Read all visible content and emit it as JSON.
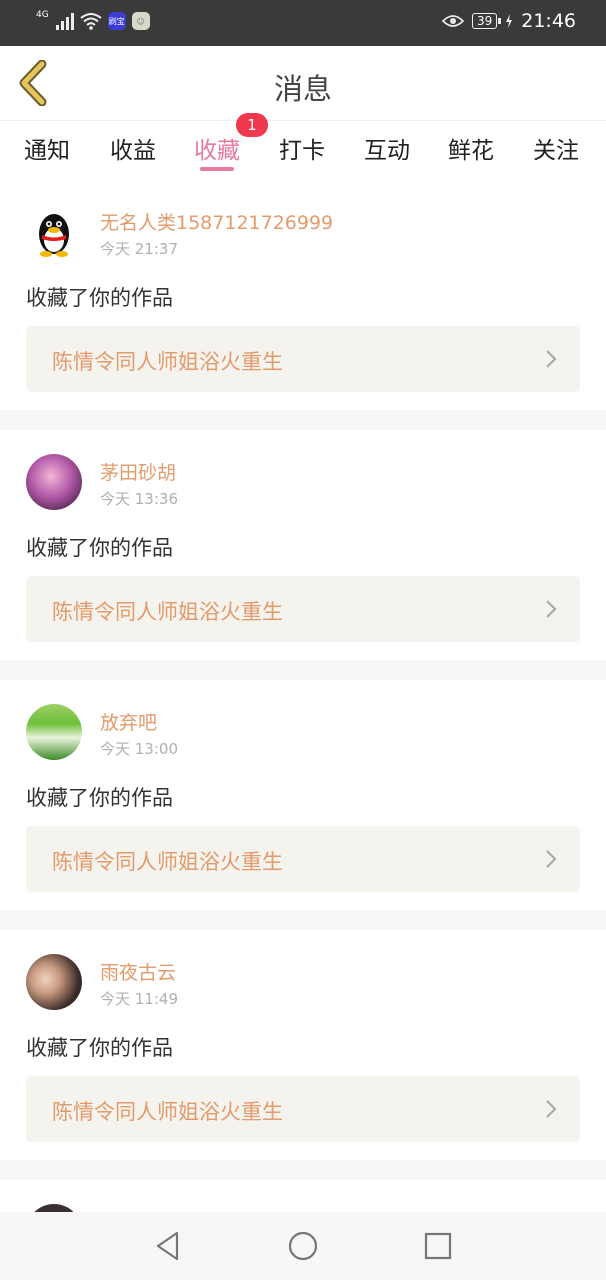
{
  "status": {
    "network": "4G",
    "badge_app": "刷宝",
    "battery": "39",
    "time": "21:46"
  },
  "header": {
    "title": "消息"
  },
  "tabs": [
    {
      "label": "通知"
    },
    {
      "label": "收益"
    },
    {
      "label": "收藏",
      "badge": "1",
      "active": true
    },
    {
      "label": "打卡"
    },
    {
      "label": "互动"
    },
    {
      "label": "鲜花"
    },
    {
      "label": "关注"
    }
  ],
  "messages": [
    {
      "user": "无名人类1587121726999",
      "time": "今天 21:37",
      "action": "收藏了你的作品",
      "work": "陈情令同人师姐浴火重生"
    },
    {
      "user": "茅田砂胡",
      "time": "今天 13:36",
      "action": "收藏了你的作品",
      "work": "陈情令同人师姐浴火重生"
    },
    {
      "user": "放弃吧",
      "time": "今天 13:00",
      "action": "收藏了你的作品",
      "work": "陈情令同人师姐浴火重生"
    },
    {
      "user": "雨夜古云",
      "time": "今天 11:49",
      "action": "收藏了你的作品",
      "work": "陈情令同人师姐浴火重生"
    }
  ],
  "colors": {
    "accent": "#e87a9e",
    "username": "#e39b6b",
    "badge": "#f0384f",
    "back_icon": "#c9a640"
  },
  "icons": [
    "signal-icon",
    "wifi-icon",
    "eye-icon",
    "battery-icon",
    "charging-icon",
    "back-arrow-icon",
    "chevron-right-icon",
    "nav-back-icon",
    "nav-home-icon",
    "nav-recents-icon"
  ]
}
